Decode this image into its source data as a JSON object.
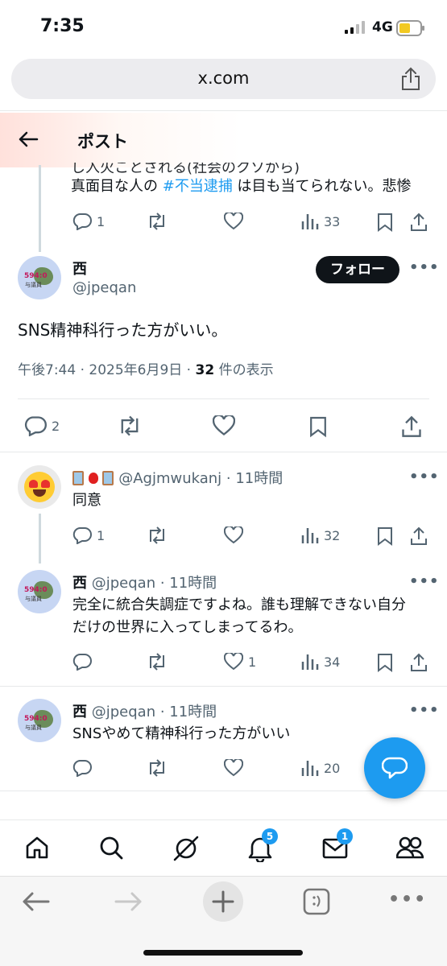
{
  "status_bar": {
    "time": "7:35",
    "network": "4G"
  },
  "browser": {
    "url": "x.com"
  },
  "header": {
    "title": "ポスト"
  },
  "previous_post": {
    "partial_line": "し入火ことされる(社会のクソから)",
    "line_prefix": "真面目な人の ",
    "hashtag": "#不当逮捕",
    "line_suffix": " は目も当てられない。悲惨",
    "replies": "1",
    "views": "33"
  },
  "main_post": {
    "name": "西",
    "handle": "@jpeqan",
    "avatar_text_1": "594:0",
    "avatar_text_2": "与議員",
    "follow_label": "フォロー",
    "text": "SNS精神科行った方がいい。",
    "timestamp": "午後7:44 · 2025年6月9日 · ",
    "views_count": "32",
    "views_label": " 件の表示",
    "replies": "2"
  },
  "replies": [
    {
      "name": "",
      "handle": "@Agjmwukanj · 11時間",
      "text": "同意",
      "replies": "1",
      "likes": "",
      "views": "32"
    },
    {
      "name": "西",
      "handle": "@jpeqan · 11時間",
      "text_line1": "完全に統合失調症ですよね。誰も理解できない自分",
      "text_line2": "だけの世界に入ってしまってるわ。",
      "replies": "",
      "likes": "1",
      "views": "34"
    },
    {
      "name": "西",
      "handle": "@jpeqan · 11時間",
      "text": "SNSやめて精神科行った方がいい",
      "replies": "",
      "likes": "",
      "views": "20"
    }
  ],
  "tab_bar": {
    "notifications_badge": "5",
    "messages_badge": "1"
  },
  "icons": [
    "back-arrow-icon",
    "share-icon",
    "reply-icon",
    "repost-icon",
    "like-icon",
    "views-icon",
    "bookmark-icon",
    "home-icon",
    "search-icon",
    "grok-icon",
    "bell-icon",
    "mail-icon",
    "people-icon",
    "compose-message-icon"
  ],
  "colors": {
    "accent": "#1d9bf0",
    "text": "#0f1419",
    "muted": "#536471",
    "follow_bg": "#0f1419"
  }
}
